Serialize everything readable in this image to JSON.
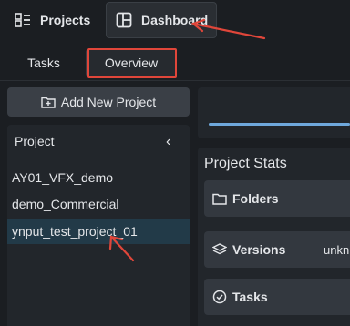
{
  "topbar": {
    "projects_label": "Projects",
    "dashboard_label": "Dashboard"
  },
  "tabs": [
    {
      "label": "Tasks"
    },
    {
      "label": "Overview"
    }
  ],
  "sidebar": {
    "add_button_label": "Add New Project",
    "header": "Project",
    "collapse_glyph": "‹",
    "projects": [
      {
        "name": "AY01_VFX_demo"
      },
      {
        "name": "demo_Commercial"
      },
      {
        "name": "ynput_test_project_01",
        "selected": true
      }
    ]
  },
  "stats": {
    "title": "Project Stats",
    "rows": [
      {
        "label": "Folders",
        "icon": "folder-icon",
        "value": ""
      },
      {
        "label": "Versions",
        "icon": "layers-icon",
        "value": "unkn"
      },
      {
        "label": "Tasks",
        "icon": "check-circle-icon",
        "value": ""
      }
    ]
  },
  "annotation_color": "#e0463a",
  "accent_progress_color": "#6fa8dc",
  "selected_row_color": "#223a48"
}
